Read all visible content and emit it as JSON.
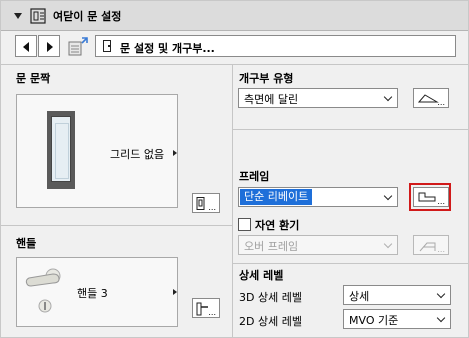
{
  "header": {
    "title": "여닫이 문 설정",
    "icon": "door-settings-icon"
  },
  "toolbar": {
    "dropdown_label": "문 설정 및 개구부..."
  },
  "left": {
    "door_panel": {
      "title": "문 문짝",
      "preview_text": "그리드 없음"
    },
    "handle_panel": {
      "title": "핸들",
      "preview_text": "핸들 3"
    }
  },
  "right": {
    "opening_type": {
      "title": "개구부 유형",
      "value": "측면에 달린"
    },
    "frame": {
      "title": "프레임",
      "value": "단순 리베이트"
    },
    "natural_vent": {
      "label": "자연 환기",
      "checked": false,
      "value": "오버 프레임"
    },
    "detail_level": {
      "title": "상세 레벨",
      "rows": [
        {
          "label": "3D 상세 레벨",
          "value": "상세"
        },
        {
          "label": "2D 상세 레벨",
          "value": "MVO 기준"
        }
      ]
    }
  },
  "colors": {
    "selection": "#1e6fd9",
    "highlight_border": "#d11a1a"
  }
}
